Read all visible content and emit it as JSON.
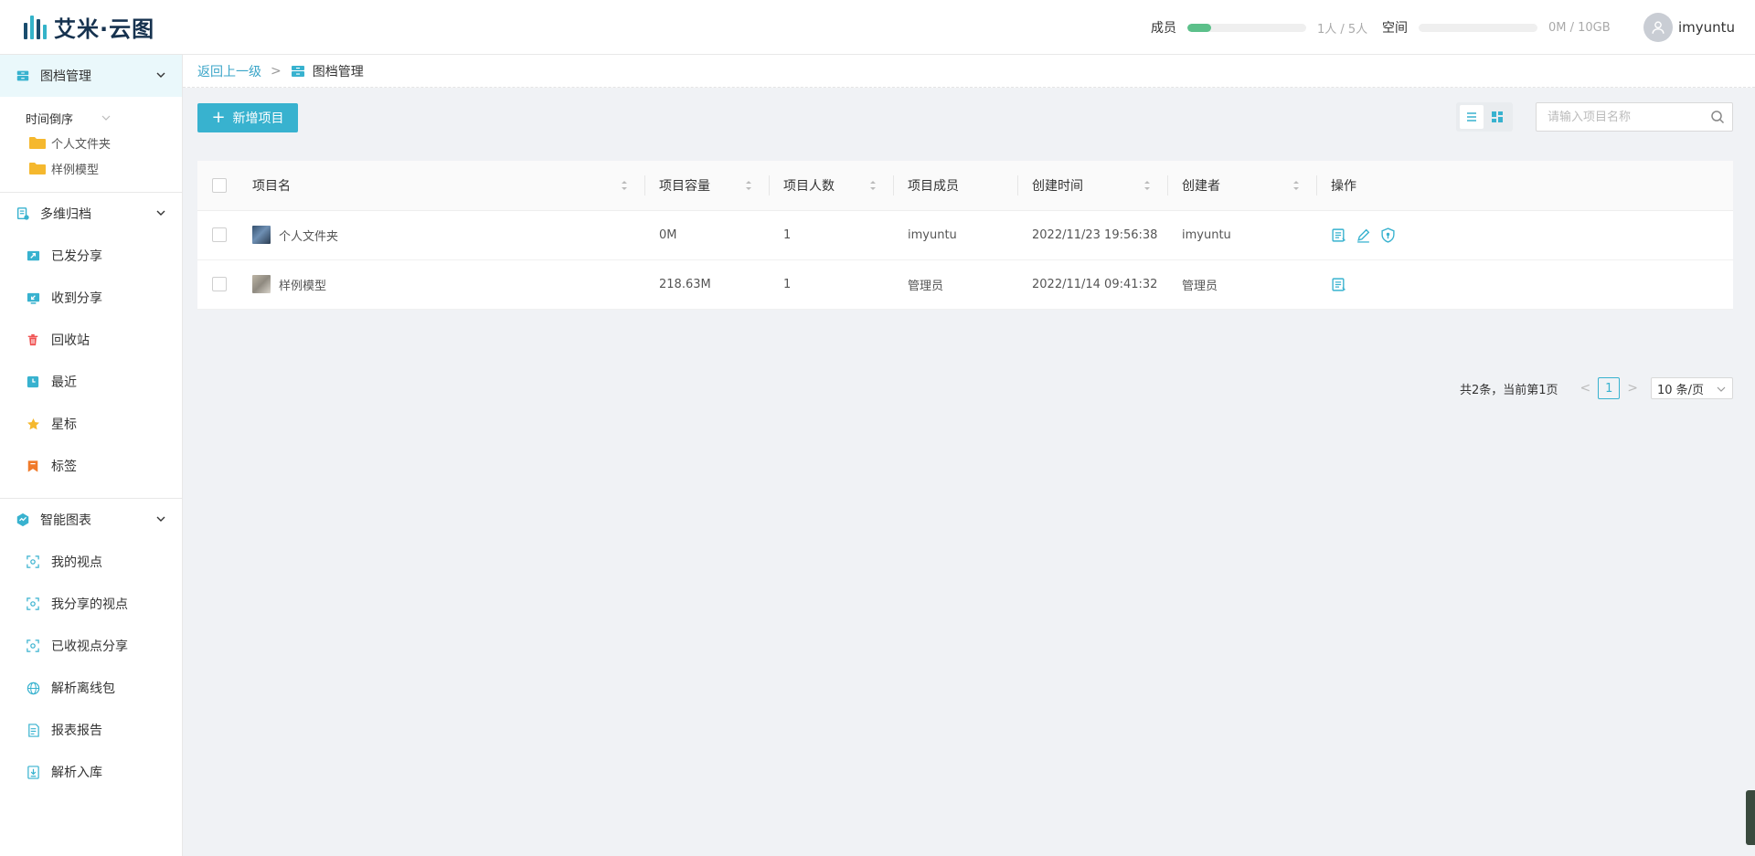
{
  "app": {
    "logo_text": "艾米·云图"
  },
  "header": {
    "members": {
      "label": "成员",
      "value": "1人 / 5人",
      "fraction": 0.2
    },
    "space": {
      "label": "空间",
      "value": "0M / 10GB",
      "fraction": 0
    },
    "user": {
      "name": "imyuntu"
    }
  },
  "sidebar": {
    "group1": {
      "label": "图档管理",
      "sort_label": "时间倒序",
      "folders": [
        {
          "label": "个人文件夹"
        },
        {
          "label": "样例模型"
        }
      ]
    },
    "group2": {
      "label": "多维归档",
      "items": [
        {
          "label": "已发分享",
          "icon": "share-out-icon"
        },
        {
          "label": "收到分享",
          "icon": "share-in-icon"
        },
        {
          "label": "回收站",
          "icon": "trash-icon"
        },
        {
          "label": "最近",
          "icon": "clock-icon"
        },
        {
          "label": "星标",
          "icon": "star-icon"
        },
        {
          "label": "标签",
          "icon": "bookmark-icon"
        }
      ]
    },
    "group3": {
      "label": "智能图表",
      "items": [
        {
          "label": "我的视点",
          "icon": "scan-icon"
        },
        {
          "label": "我分享的视点",
          "icon": "scan-icon"
        },
        {
          "label": "已收视点分享",
          "icon": "scan-icon"
        },
        {
          "label": "解析离线包",
          "icon": "globe-icon"
        },
        {
          "label": "报表报告",
          "icon": "report-icon"
        },
        {
          "label": "解析入库",
          "icon": "import-icon"
        }
      ]
    }
  },
  "breadcrumb": {
    "back": "返回上一级",
    "sep": ">",
    "current": "图档管理"
  },
  "toolbar": {
    "add_label": "新增项目",
    "search_placeholder": "请输入项目名称"
  },
  "table": {
    "columns": [
      "项目名",
      "项目容量",
      "项目人数",
      "项目成员",
      "创建时间",
      "创建者",
      "操作"
    ],
    "rows": [
      {
        "name": "个人文件夹",
        "size": "0M",
        "count": "1",
        "members": "imyuntu",
        "created": "2022/11/23 19:56:38",
        "creator": "imyuntu"
      },
      {
        "name": "样例模型",
        "size": "218.63M",
        "count": "1",
        "members": "管理员",
        "created": "2022/11/14 09:41:32",
        "creator": "管理员"
      }
    ]
  },
  "pagination": {
    "total_text": "共2条，当前第1页",
    "prev": "<",
    "page": "1",
    "next": ">",
    "page_size": "10 条/页"
  },
  "colors": {
    "accent": "#38b2cf",
    "progress": "#5cc08a",
    "folder": "#f5b82e",
    "trash": "#f05050",
    "star": "#f5b82e",
    "bookmark": "#f07a2a"
  }
}
